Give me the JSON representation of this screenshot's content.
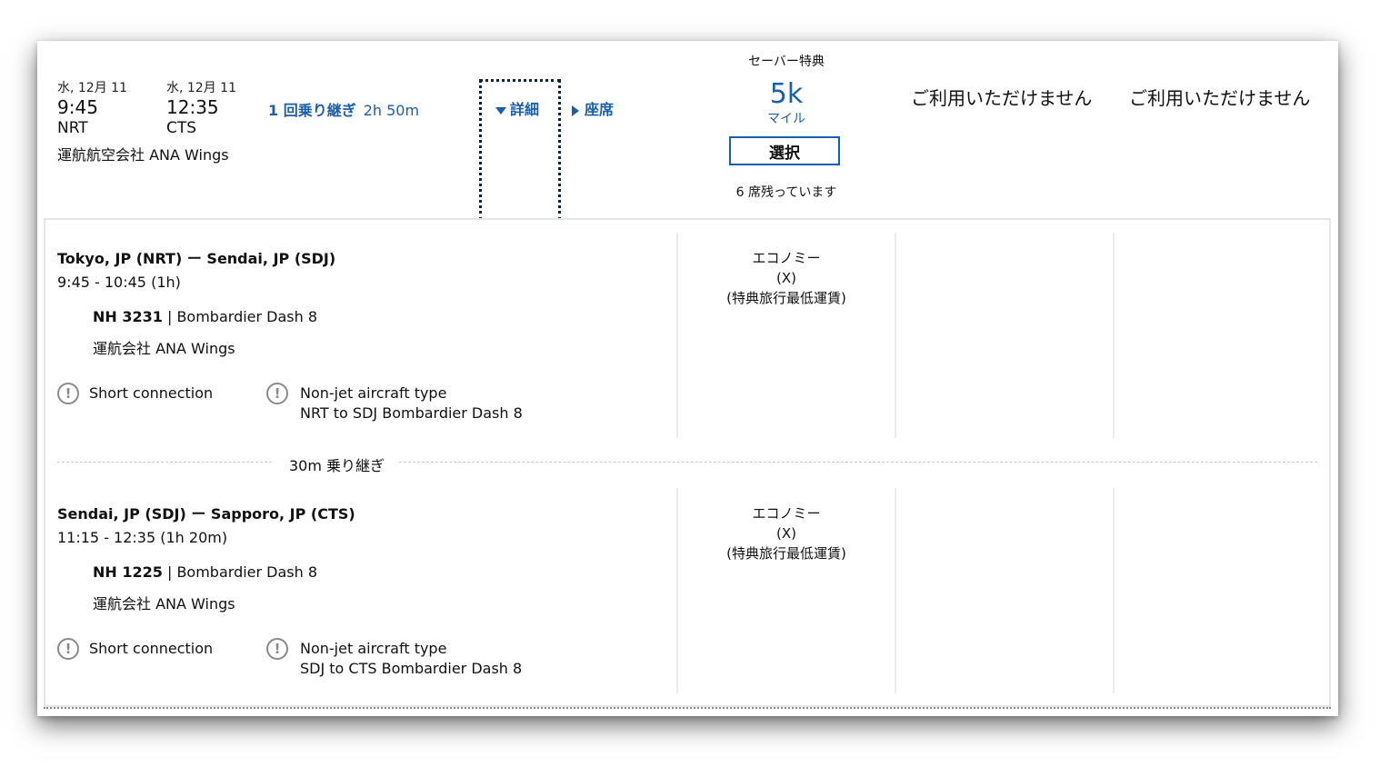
{
  "summary": {
    "departure": {
      "date": "水, 12月 11",
      "time": "9:45",
      "airport": "NRT"
    },
    "arrival": {
      "date": "水, 12月 11",
      "time": "12:35",
      "airport": "CTS"
    },
    "operator": "運航航空会社 ANA Wings",
    "connection_label": "1 回乗り継ぎ",
    "duration": "2h 50m",
    "details_label": "詳細",
    "seats_label": "座席",
    "fare": {
      "name": "セーバー特典",
      "miles": "5k",
      "unit": "マイル",
      "select_label": "選択",
      "seats_left": "6 席残っています"
    },
    "unavailable": [
      "ご利用いただけません",
      "ご利用いただけません"
    ]
  },
  "segments": [
    {
      "route": "Tokyo, JP (NRT) ー Sendai, JP (SDJ)",
      "time": "9:45 - 10:45 (1h)",
      "flight_number": "NH 3231",
      "aircraft": " | Bombardier Dash 8",
      "operator": "運航会社 ANA Wings",
      "warnings": [
        {
          "title": "Short connection",
          "detail": ""
        },
        {
          "title": "Non-jet aircraft type",
          "detail": "NRT to SDJ Bombardier Dash 8"
        }
      ],
      "cabin": [
        "エコノミー",
        "(X)",
        "(特典旅行最低運賃)"
      ]
    },
    {
      "route": "Sendai, JP (SDJ) ー Sapporo, JP (CTS)",
      "time": "11:15 - 12:35 (1h 20m)",
      "flight_number": "NH 1225",
      "aircraft": " | Bombardier Dash 8",
      "operator": "運航会社 ANA Wings",
      "warnings": [
        {
          "title": "Short connection",
          "detail": ""
        },
        {
          "title": "Non-jet aircraft type",
          "detail": "SDJ to CTS Bombardier Dash 8"
        }
      ],
      "cabin": [
        "エコノミー",
        "(X)",
        "(特典旅行最低運賃)"
      ]
    }
  ],
  "layover": "30m 乗り継ぎ",
  "icons": {
    "warning": "exclamation-circle-icon",
    "details_toggle": "caret-down-icon",
    "seats_toggle": "caret-right-icon"
  },
  "colors": {
    "link": "#1a5fad",
    "focus_outline": "#0c2340"
  }
}
